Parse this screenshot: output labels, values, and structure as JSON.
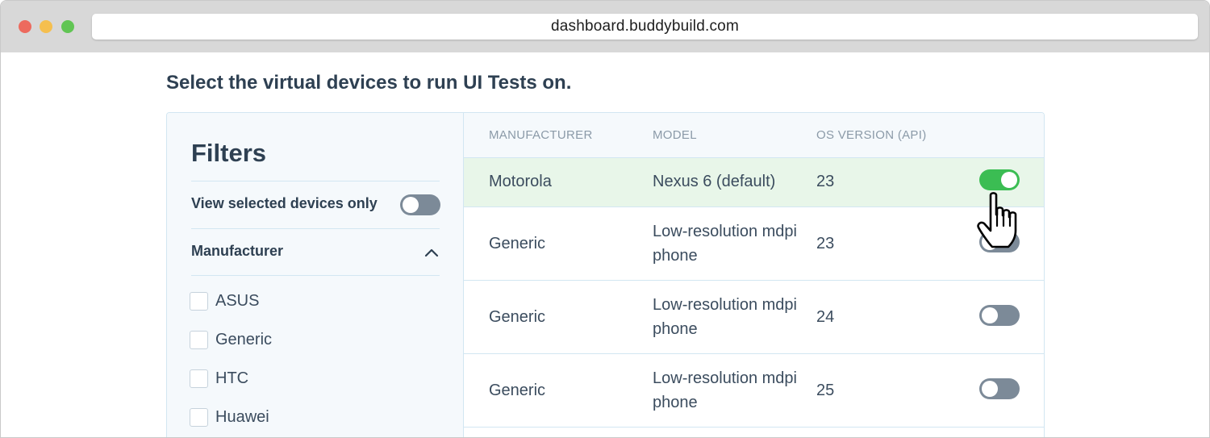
{
  "browser": {
    "url": "dashboard.buddybuild.com"
  },
  "page": {
    "heading": "Select the virtual devices to run UI Tests on."
  },
  "filters": {
    "title": "Filters",
    "view_selected_label": "View selected devices only",
    "view_selected_on": false,
    "manufacturer_section_label": "Manufacturer",
    "manufacturer_section_expanded": true,
    "manufacturers": [
      {
        "label": "ASUS",
        "checked": false
      },
      {
        "label": "Generic",
        "checked": false
      },
      {
        "label": "HTC",
        "checked": false
      },
      {
        "label": "Huawei",
        "checked": false
      }
    ]
  },
  "table": {
    "headers": [
      "MANUFACTURER",
      "MODEL",
      "OS VERSION (API)"
    ],
    "rows": [
      {
        "manufacturer": "Motorola",
        "model": "Nexus 6 (default)",
        "os": "23",
        "enabled": true
      },
      {
        "manufacturer": "Generic",
        "model": "Low-resolution mdpi phone",
        "os": "23",
        "enabled": false
      },
      {
        "manufacturer": "Generic",
        "model": "Low-resolution mdpi phone",
        "os": "24",
        "enabled": false
      },
      {
        "manufacturer": "Generic",
        "model": "Low-resolution mdpi phone",
        "os": "25",
        "enabled": false
      }
    ]
  },
  "colors": {
    "toggle_on": "#3bbd53",
    "toggle_off": "#7c8a98",
    "selected_row": "#e8f6e9",
    "text_primary": "#2e4052"
  },
  "icons": {
    "cursor": "hand-pointer-icon",
    "collapse": "chevron-up-icon"
  }
}
